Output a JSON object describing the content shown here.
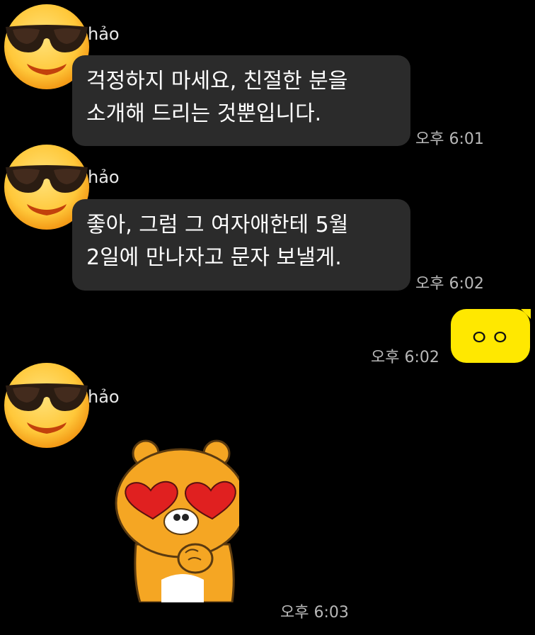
{
  "messages": [
    {
      "sender": "hảo",
      "lines": [
        "걱정하지 마세요, 친절한 분을",
        "소개해 드리는 것뿐입니다."
      ],
      "time": "오후 6:01",
      "avatar_icon": "sunglasses-emoji-icon"
    },
    {
      "sender": "hảo",
      "lines": [
        "좋아, 그럼 그 여자애한테 5월",
        "2일에 만나자고 문자 보낼게."
      ],
      "time": "오후 6:02",
      "avatar_icon": "sunglasses-emoji-icon"
    },
    {
      "mine": true,
      "text": "ㅇㅇ",
      "time": "오후 6:02",
      "bubble_color": "#ffe800"
    },
    {
      "sender": "hảo",
      "sticker": "ryan-heart-eyes-sticker-icon",
      "time": "오후 6:03",
      "avatar_icon": "sunglasses-emoji-icon"
    }
  ],
  "colors": {
    "background": "#000000",
    "incoming_bubble": "#2b2b2b",
    "outgoing_bubble": "#ffe800",
    "timestamp": "#b8b8b8"
  }
}
